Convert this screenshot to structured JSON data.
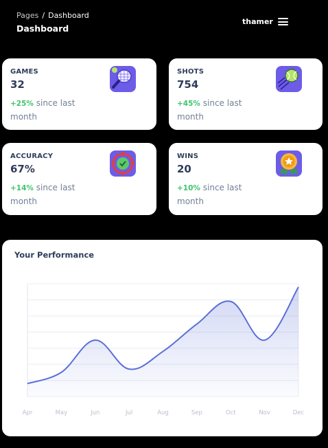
{
  "header": {
    "breadcrumb_root": "Pages",
    "breadcrumb_sep": "/",
    "breadcrumb_current": "Dashboard",
    "page_title": "Dashboard",
    "user_name": "thamer"
  },
  "stats": [
    {
      "label": "GAMES",
      "value": "32",
      "delta": "+25%",
      "delta_text": "since last month",
      "icon": "tennis-racket-icon"
    },
    {
      "label": "SHOTS",
      "value": "754",
      "delta": "+45%",
      "delta_text": "since last month",
      "icon": "tennis-ball-icon"
    },
    {
      "label": "ACCURACY",
      "value": "67%",
      "delta": "+14%",
      "delta_text": "since last month",
      "icon": "target-icon"
    },
    {
      "label": "WINS",
      "value": "20",
      "delta": "+10%",
      "delta_text": "since last month",
      "icon": "medal-icon"
    }
  ],
  "colors": {
    "accent": "#5a6fd6",
    "positive": "#3ec46d",
    "icon_bg": "#6c5ce7"
  },
  "performance": {
    "title": "Your Performance"
  },
  "chart_data": {
    "type": "area",
    "categories": [
      "Apr",
      "May",
      "Jun",
      "Jul",
      "Aug",
      "Sep",
      "Oct",
      "Nov",
      "Dec"
    ],
    "values": [
      8,
      15,
      35,
      17,
      28,
      45,
      59,
      35,
      68
    ],
    "ylim": [
      0,
      70
    ],
    "grid": true,
    "title": "",
    "xlabel": "",
    "ylabel": ""
  }
}
